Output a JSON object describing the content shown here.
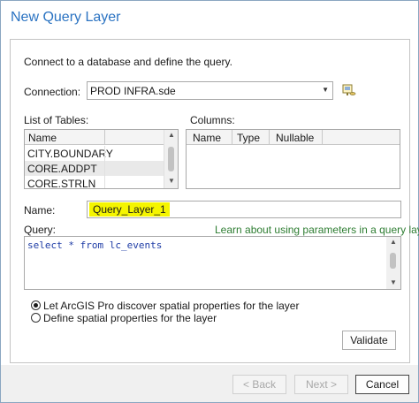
{
  "window": {
    "title": "New Query Layer"
  },
  "intro": "Connect to a database and define the query.",
  "connection": {
    "label": "Connection:",
    "value": "PROD INFRA.sde"
  },
  "tables": {
    "label": "List of Tables:",
    "header": "Name",
    "rows": [
      "CITY.BOUNDARY",
      "CORE.ADDPT",
      "CORE.STRLN"
    ]
  },
  "columns": {
    "label": "Columns:",
    "headers": [
      "Name",
      "Type",
      "Nullable"
    ]
  },
  "name": {
    "label": "Name:",
    "value": "Query_Layer_1"
  },
  "query": {
    "label": "Query:",
    "help_link": "Learn about using parameters in a query layer",
    "text": "select * from lc_events"
  },
  "spatial": {
    "option1": "Let ArcGIS Pro discover spatial properties for the layer",
    "option2": "Define spatial properties for the layer",
    "selected": 1
  },
  "buttons": {
    "validate": "Validate",
    "back": "< Back",
    "next": "Next >",
    "cancel": "Cancel"
  },
  "colors": {
    "title": "#2b73c2",
    "link": "#2e7d32",
    "highlight": "#f5f500"
  }
}
